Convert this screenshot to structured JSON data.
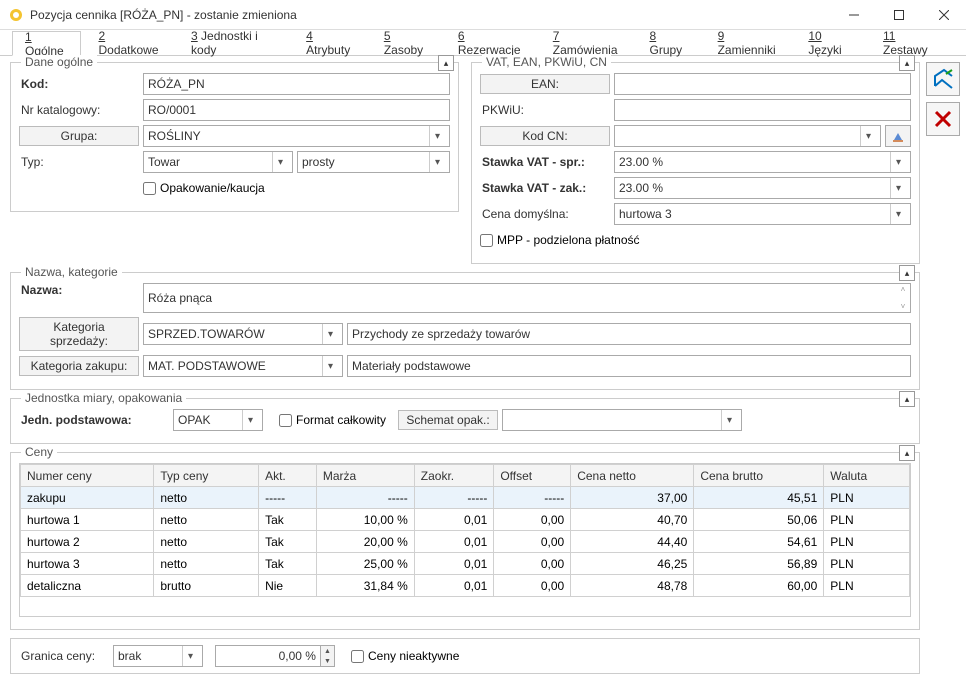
{
  "window": {
    "title": "Pozycja cennika [RÓŻA_PN] - zostanie zmieniona"
  },
  "tabs": [
    {
      "n": "1",
      "label": "Ogólne"
    },
    {
      "n": "2",
      "label": "Dodatkowe"
    },
    {
      "n": "3",
      "label": "Jednostki i kody"
    },
    {
      "n": "4",
      "label": "Atrybuty"
    },
    {
      "n": "5",
      "label": "Zasoby"
    },
    {
      "n": "6",
      "label": "Rezerwacje"
    },
    {
      "n": "7",
      "label": "Zamówienia"
    },
    {
      "n": "8",
      "label": "Grupy"
    },
    {
      "n": "9",
      "label": "Zamienniki"
    },
    {
      "n": "10",
      "label": "Języki"
    },
    {
      "n": "11",
      "label": "Zestawy"
    }
  ],
  "general": {
    "legend": "Dane ogólne",
    "kod_lbl": "Kod:",
    "kod": "RÓŻA_PN",
    "nrkat_lbl": "Nr katalogowy:",
    "nrkat": "RO/0001",
    "grupa_lbl": "Grupa:",
    "grupa": "ROŚLINY",
    "typ_lbl": "Typ:",
    "typ": "Towar",
    "typ2": "prosty",
    "opak_lbl": "Opakowanie/kaucja"
  },
  "vat": {
    "legend": "VAT, EAN, PKWiU, CN",
    "ean_lbl": "EAN:",
    "ean": "",
    "pkwiu_lbl": "PKWiU:",
    "pkwiu": "",
    "cn_lbl": "Kod CN:",
    "cn": "",
    "vat_spr_lbl": "Stawka VAT - spr.:",
    "vat_spr": "23.00 %",
    "vat_zak_lbl": "Stawka VAT - zak.:",
    "vat_zak": "23.00 %",
    "cena_dom_lbl": "Cena domyślna:",
    "cena_dom": "hurtowa 3",
    "mpp_lbl": "MPP - podzielona płatność"
  },
  "namecat": {
    "legend": "Nazwa, kategorie",
    "nazwa_lbl": "Nazwa:",
    "nazwa": "Róża pnąca",
    "katspr_lbl": "Kategoria sprzedaży:",
    "katspr": "SPRZED.TOWARÓW",
    "katspr_desc": "Przychody ze sprzedaży towarów",
    "katzak_lbl": "Kategoria zakupu:",
    "katzak": "MAT. PODSTAWOWE",
    "katzak_desc": "Materiały podstawowe"
  },
  "unit": {
    "legend": "Jednostka miary, opakowania",
    "podst_lbl": "Jedn. podstawowa:",
    "podst": "OPAK",
    "format_lbl": "Format całkowity",
    "schemat_lbl": "Schemat opak.:",
    "schemat": ""
  },
  "prices": {
    "legend": "Ceny",
    "headers": [
      "Numer ceny",
      "Typ ceny",
      "Akt.",
      "Marża",
      "Zaokr.",
      "Offset",
      "Cena netto",
      "Cena brutto",
      "Waluta"
    ],
    "rows": [
      {
        "numer": "zakupu",
        "typ": "netto",
        "akt": "-----",
        "marza": "-----",
        "zaokr": "-----",
        "offset": "-----",
        "netto": "37,00",
        "brutto": "45,51",
        "waluta": "PLN"
      },
      {
        "numer": "hurtowa 1",
        "typ": "netto",
        "akt": "Tak",
        "marza": "10,00 %",
        "zaokr": "0,01",
        "offset": "0,00",
        "netto": "40,70",
        "brutto": "50,06",
        "waluta": "PLN"
      },
      {
        "numer": "hurtowa 2",
        "typ": "netto",
        "akt": "Tak",
        "marza": "20,00 %",
        "zaokr": "0,01",
        "offset": "0,00",
        "netto": "44,40",
        "brutto": "54,61",
        "waluta": "PLN"
      },
      {
        "numer": "hurtowa 3",
        "typ": "netto",
        "akt": "Tak",
        "marza": "25,00 %",
        "zaokr": "0,01",
        "offset": "0,00",
        "netto": "46,25",
        "brutto": "56,89",
        "waluta": "PLN"
      },
      {
        "numer": "detaliczna",
        "typ": "brutto",
        "akt": "Nie",
        "marza": "31,84 %",
        "zaokr": "0,01",
        "offset": "0,00",
        "netto": "48,78",
        "brutto": "60,00",
        "waluta": "PLN"
      }
    ]
  },
  "footer": {
    "granica_lbl": "Granica ceny:",
    "granica": "brak",
    "granica_pct": "0,00 %",
    "nieakt_lbl": "Ceny nieaktywne"
  }
}
